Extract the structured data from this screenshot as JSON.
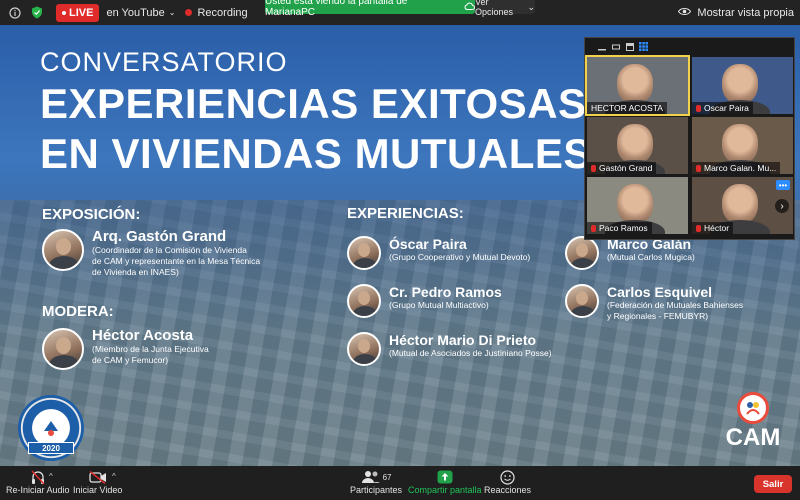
{
  "topbar": {
    "live_label": "LIVE",
    "stream_target": "en YouTube",
    "recording_label": "Recording",
    "share_banner": "Usted está viendo la pantalla de MarianaPC",
    "view_options": "Ver Opciones",
    "full_view": "Mostrar vista propia"
  },
  "slide": {
    "pretitle": "CONVERSATORIO",
    "title_line1": "EXPERIENCIAS EXITOSAS",
    "title_line2": "EN VIVIENDAS MUTUALES",
    "exposicion_heading": "EXPOSICIÓN:",
    "expositor": {
      "name": "Arq. Gastón Grand",
      "desc_1": "(Coordinador de la Comisión de Vivienda",
      "desc_2": "de CAM y representante en la Mesa Técnica",
      "desc_3": "de Vivienda en INAES)"
    },
    "modera_heading": "MODERA:",
    "moderador": {
      "name": "Héctor Acosta",
      "desc_1": "(Miembro de la Junta Ejecutiva",
      "desc_2": "de CAM y Femucor)"
    },
    "experiencias_heading": "EXPERIENCIAS:",
    "experiences": [
      {
        "name": "Óscar Paira",
        "desc_1": "(Grupo Cooperativo y Mutual Devoto)",
        "desc_2": ""
      },
      {
        "name": "Cr. Pedro Ramos",
        "desc_1": "(Grupo Mutual Multiactivo)",
        "desc_2": ""
      },
      {
        "name": "Héctor Mario Di Prieto",
        "desc_1": "(Mutual de Asociados de Justiniano Posse)",
        "desc_2": ""
      },
      {
        "name": "Marco Galán",
        "desc_1": "(Mutual Carlos Mugica)",
        "desc_2": ""
      },
      {
        "name": "Carlos Esquivel",
        "desc_1": "(Federación de Mutuales Bahienses",
        "desc_2": "y Regionales - FEMUBYR)"
      }
    ],
    "badge_year": "2020",
    "cam_label": "CAM"
  },
  "gallery": {
    "participants": [
      {
        "label": "HECTOR ACOSTA",
        "muted": false,
        "active": true
      },
      {
        "label": "Oscar Paira",
        "muted": true,
        "active": false
      },
      {
        "label": "Gastón Grand",
        "muted": true,
        "active": false
      },
      {
        "label": "Marco Galan. Mu...",
        "muted": true,
        "active": false
      },
      {
        "label": "Paco Ramos",
        "muted": true,
        "active": false
      },
      {
        "label": "Héctor",
        "muted": true,
        "active": false
      }
    ],
    "more_label": "•••",
    "next_label": "›"
  },
  "bottombar": {
    "audio_label": "Re-Iniciar Audio",
    "video_label": "Iniciar Video",
    "participants_label": "Participantes",
    "participants_count": "67",
    "share_label": "Compartir pantalla",
    "reactions_label": "Reacciones",
    "leave_label": "Salir"
  },
  "colors": {
    "live_red": "#e02b2b",
    "share_green": "#21a24a",
    "leave_red": "#d9342b",
    "active_tile": "#f2d24a"
  }
}
